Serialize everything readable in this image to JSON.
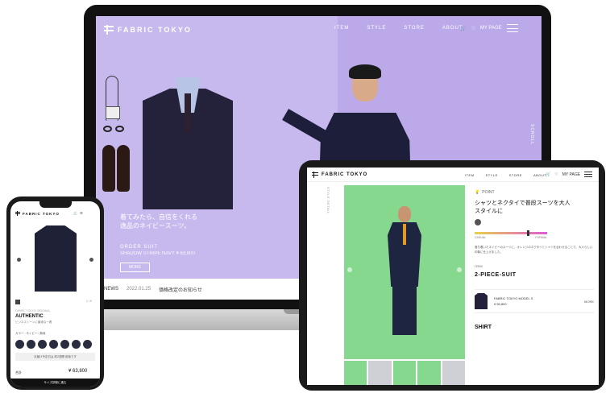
{
  "laptop": {
    "brand": "FABRIC TOKYO",
    "nav": [
      "ITEM",
      "STYLE",
      "STORE",
      "ABOUT"
    ],
    "cart_count": "1",
    "mypage": "MY PAGE",
    "hero": {
      "headline_line1": "着てみたら、自信をくれる",
      "headline_line2": "逸品のネイビースーツ。",
      "product": "ORDER SUIT",
      "product_detail": "SHADOW STRIPE NAVY",
      "price": "¥ 63,800",
      "more": "MORE"
    },
    "scroll_label": "SCROLL",
    "news": {
      "label": "NEWS",
      "date": "2022.01.25",
      "text": "価格改定のお知らせ"
    }
  },
  "tablet": {
    "brand": "FABRIC TOKYO",
    "nav": [
      "ITEM",
      "STYLE",
      "STORE",
      "ABOUT"
    ],
    "mypage": "MY PAGE",
    "side_label": "STYLE DETAIL",
    "point_label": "POINT",
    "heading_line1": "シャツとネクタイで普段スーツを大人",
    "heading_line2": "スタイルに",
    "gauge_left": "CASUAL",
    "gauge_right": "FORMAL",
    "gauge_position": 0.72,
    "body": "落ち着いたネイビーのスーツに、オレンジのネクタイとシャツを合わせることで、大人らしい印象に仕上げました。",
    "item_label": "ITEM",
    "item_title": "2-PIECE-SUIT",
    "card_title": "FABRIC TOKYO MODEL S",
    "card_price": "¥ 59,800",
    "card_more": "MORE",
    "shirt_title": "SHIRT"
  },
  "phone": {
    "brand": "FABRIC TOKYO",
    "pager": "1 / 5",
    "brand_small": "FABRIC TOKYO ORIGINAL",
    "title": "AUTHENTIC",
    "desc": "ビジネスシーンに最適な一着",
    "color_label": "カラー : ネイビー / 無地",
    "notice": "お届け予定日は 約2週間 前後です",
    "total_label": "合計",
    "total": "¥ 63,800",
    "cta": "サイズ診断に進む"
  },
  "colors": {
    "laptop_bg": "#c7b8ee",
    "tablet_green": "#86d88f",
    "navy": "#1f2236",
    "tie_orange": "#e49a26"
  }
}
